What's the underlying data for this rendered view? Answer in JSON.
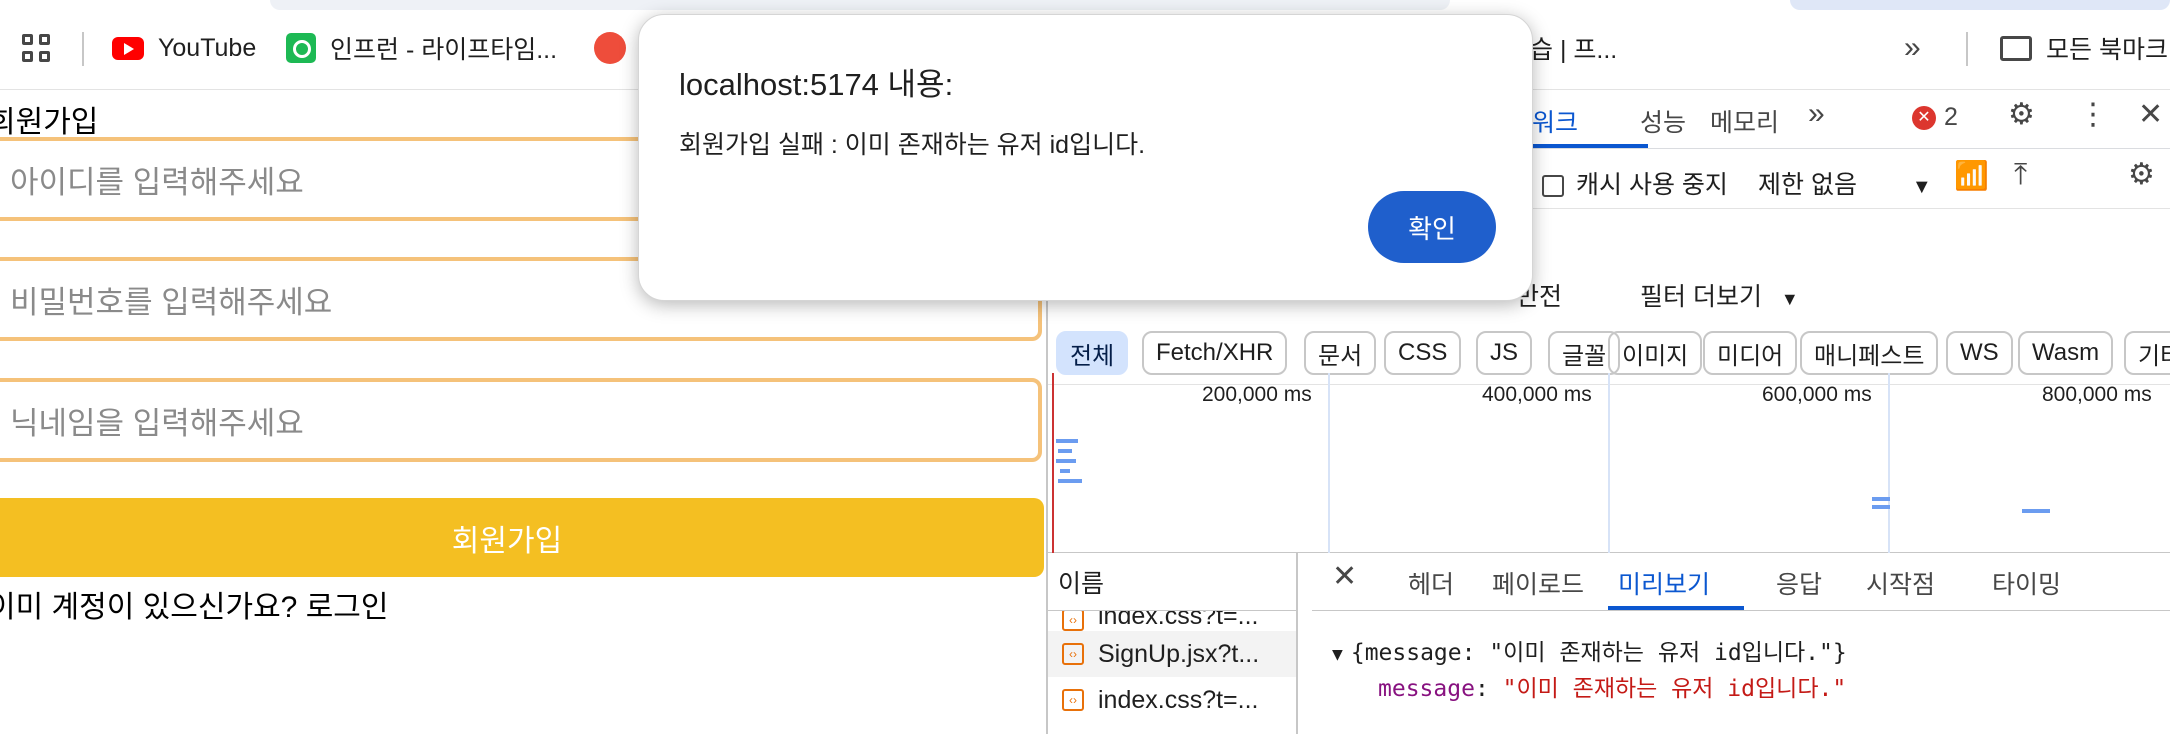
{
  "bookmarks": {
    "items": [
      {
        "label": "YouTube"
      },
      {
        "label": "인프런 - 라이프타임..."
      },
      {
        "label": "습 | 프..."
      }
    ],
    "more_label": "»",
    "all_bookmarks_label": "모든 북마크"
  },
  "page": {
    "title": "회원가입",
    "id_placeholder": "아이디를 입력해주세요",
    "password_placeholder": "비밀번호를 입력해주세요",
    "nickname_placeholder": "닉네임을 입력해주세요",
    "submit_label": "회원가입",
    "login_prompt": "이미 계정이 있으신가요? 로그인"
  },
  "devtools": {
    "tabs": [
      "워크",
      "성능",
      "메모리"
    ],
    "more_tabs": "»",
    "error_count": "2",
    "disable_cache_label": "캐시 사용 중지",
    "throttle_label": "제한 없음",
    "invert_label": "반전",
    "more_filters_label": "필터 더보기",
    "filter_chips": [
      "전체",
      "Fetch/XHR",
      "문서",
      "CSS",
      "JS",
      "글꼴",
      "이미지",
      "미디어",
      "매니페스트",
      "WS",
      "Wasm",
      "기타"
    ],
    "timeline_labels": [
      "200,000 ms",
      "400,000 ms",
      "600,000 ms",
      "800,000 ms"
    ],
    "request_list_header": "이름",
    "requests": [
      "index.css?t=...",
      "SignUp.jsx?t...",
      "index.css?t=..."
    ],
    "detail_tabs": [
      "헤더",
      "페이로드",
      "미리보기",
      "응답",
      "시작점",
      "타이밍"
    ],
    "preview_line1": "{message: \"이미 존재하는 유저 id입니다.\"}",
    "preview_key": "message",
    "preview_value": "\"이미 존재하는 유저 id입니다.\""
  },
  "dialog": {
    "title": "localhost:5174 내용:",
    "message": "회원가입 실패 : 이미 존재하는 유저 id입니다.",
    "ok_label": "확인"
  },
  "colors": {
    "accent_blue": "#0b57d0",
    "input_border": "#f5c27a",
    "submit_bg": "#f4bf22",
    "dialog_button": "#1f5fcc",
    "json_key": "#881280",
    "json_string": "#c41a16"
  }
}
